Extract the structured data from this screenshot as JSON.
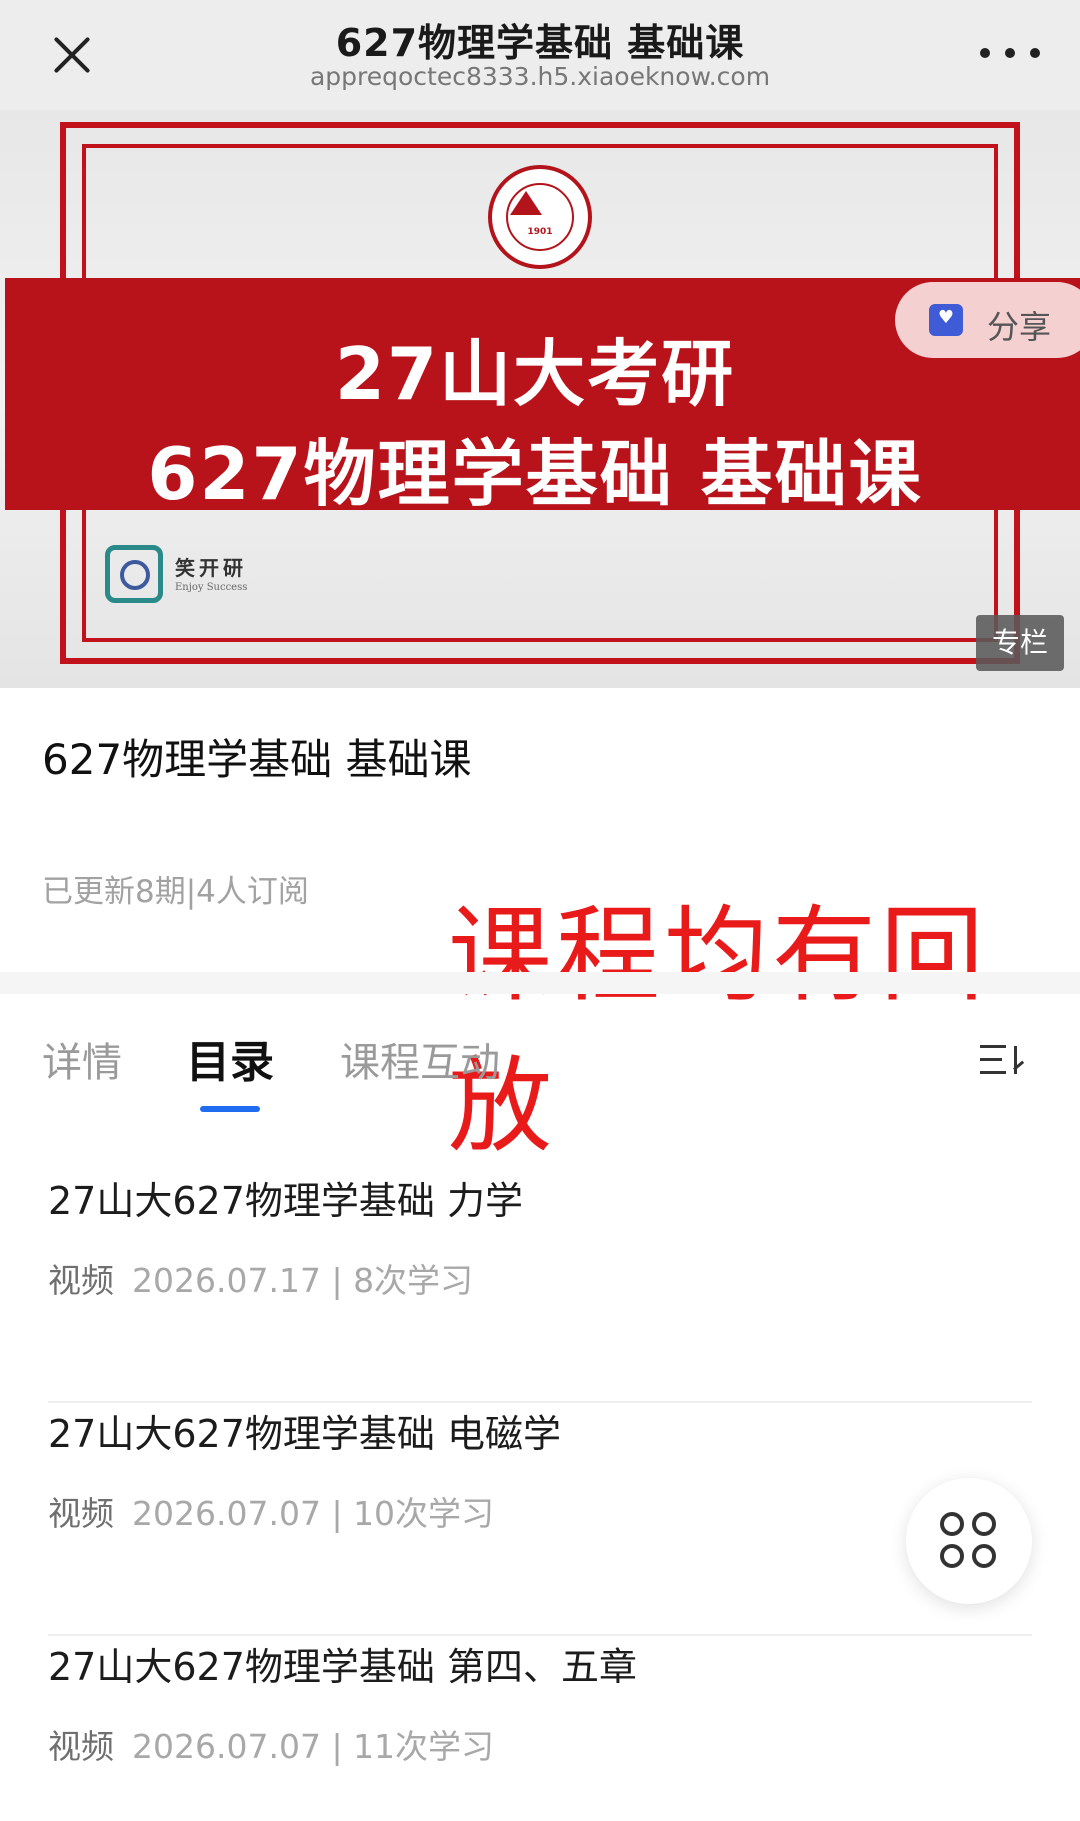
{
  "nav": {
    "title": "627物理学基础 基础课",
    "url": "appreqoctec8333.h5.xiaoeknow.com"
  },
  "banner": {
    "seal_year": "1901",
    "line1": "27山大考研",
    "line2": "627物理学基础  基础课",
    "org_name": "笑开研",
    "org_sub": "Enjoy Success",
    "share_label": "分享",
    "badge": "专栏"
  },
  "course": {
    "title": "627物理学基础 基础课",
    "meta": "已更新8期|4人订阅",
    "replay_note": "课程均有回放"
  },
  "tabs": [
    {
      "label": "详情",
      "active": false
    },
    {
      "label": "目录",
      "active": true
    },
    {
      "label": "课程互动",
      "active": false
    }
  ],
  "lessons": [
    {
      "title": "27山大627物理学基础 力学",
      "type": "视频",
      "date": "2026.07.17",
      "count": "8次学习"
    },
    {
      "title": "27山大627物理学基础 电磁学",
      "type": "视频",
      "date": "2026.07.07",
      "count": "10次学习"
    },
    {
      "title": "27山大627物理学基础 第四、五章",
      "type": "视频",
      "date": "2026.07.07",
      "count": "11次学习"
    }
  ],
  "colors": {
    "brand_red": "#b8121b",
    "highlight_red": "#e81a1a",
    "tab_accent": "#1f6cf0"
  },
  "icons": {
    "close": "close-icon",
    "more": "more-icon",
    "share": "share-icon",
    "sort": "sort-icon",
    "menu": "menu-grid-icon"
  }
}
